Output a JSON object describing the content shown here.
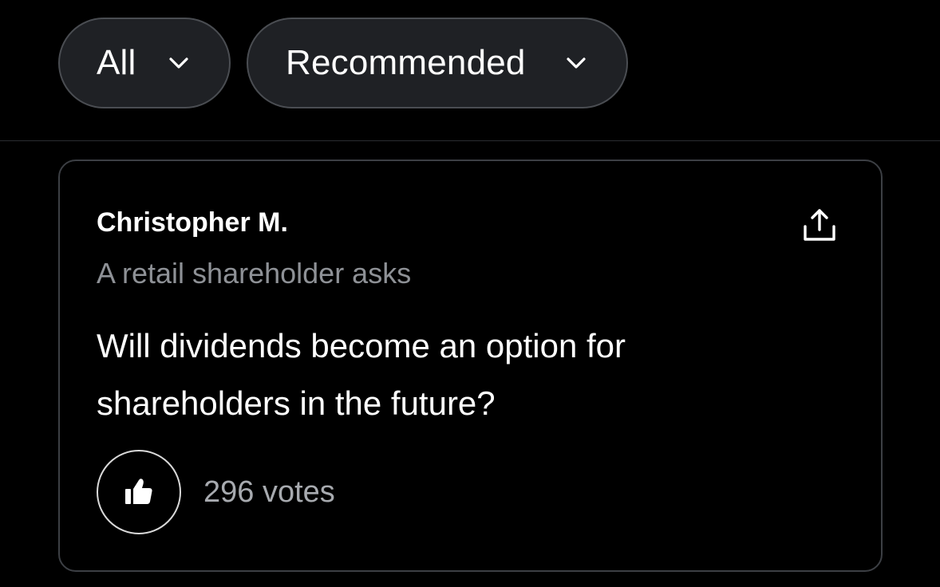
{
  "filters": {
    "scope": {
      "label": "All",
      "icon": "chevron-down-icon"
    },
    "sort": {
      "label": "Recommended",
      "icon": "chevron-down-icon"
    }
  },
  "question_card": {
    "author": "Christopher M.",
    "subtitle": "A retail shareholder asks",
    "question": "Will dividends become an option for shareholders in the future?",
    "share_icon": "share-icon",
    "upvote_icon": "thumbs-up-icon",
    "vote_count": "296",
    "vote_unit": "votes"
  },
  "colors": {
    "background": "#000000",
    "pill_background": "#1f2125",
    "pill_border": "#4a4d52",
    "card_border": "#3c3f44",
    "muted_text": "#8e9196"
  }
}
